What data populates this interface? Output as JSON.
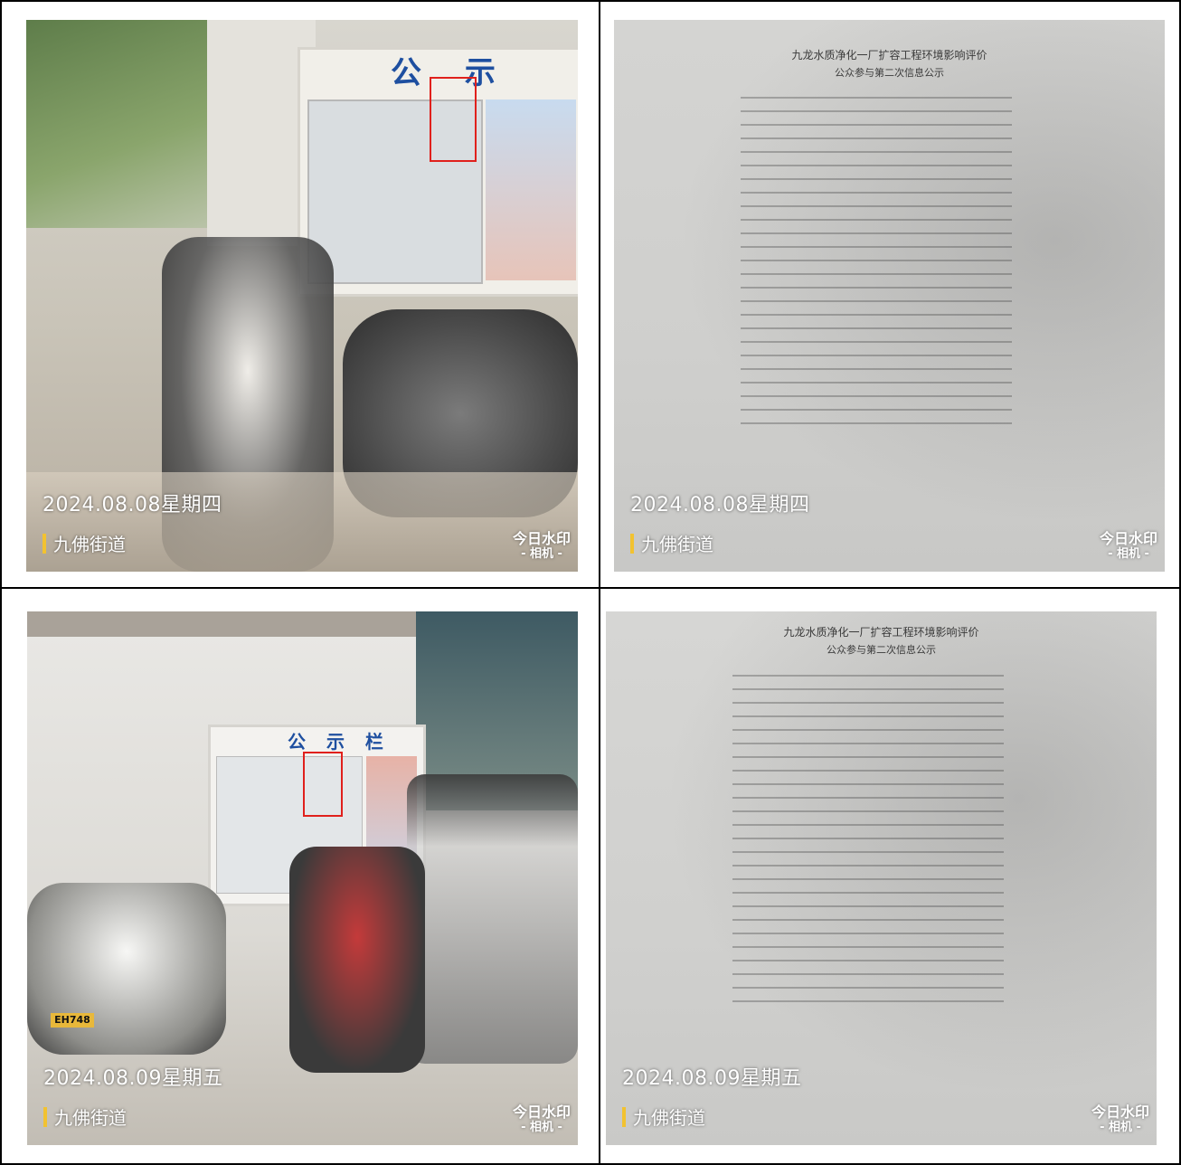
{
  "photos": [
    {
      "date": "2024.08.08星期四",
      "location": "九佛街道",
      "watermark_line1": "今日水印",
      "watermark_line2": "- 相机 -",
      "board_title": "公 示 栏"
    },
    {
      "date": "2024.08.08星期四",
      "location": "九佛街道",
      "watermark_line1": "今日水印",
      "watermark_line2": "- 相机 -",
      "doc_title": "九龙水质净化一厂扩容工程环境影响评价",
      "doc_subtitle": "公众参与第二次信息公示"
    },
    {
      "date": "2024.08.09星期五",
      "location": "九佛街道",
      "watermark_line1": "今日水印",
      "watermark_line2": "- 相机 -",
      "board_title": "公 示 栏",
      "plate": "EH748"
    },
    {
      "date": "2024.08.09星期五",
      "location": "九佛街道",
      "watermark_line1": "今日水印",
      "watermark_line2": "- 相机 -",
      "doc_title": "九龙水质净化一厂扩容工程环境影响评价",
      "doc_subtitle": "公众参与第二次信息公示"
    }
  ],
  "colors": {
    "highlight_box": "#e0201c",
    "location_bar": "#f2c230",
    "board_title": "#1e4fa0"
  }
}
